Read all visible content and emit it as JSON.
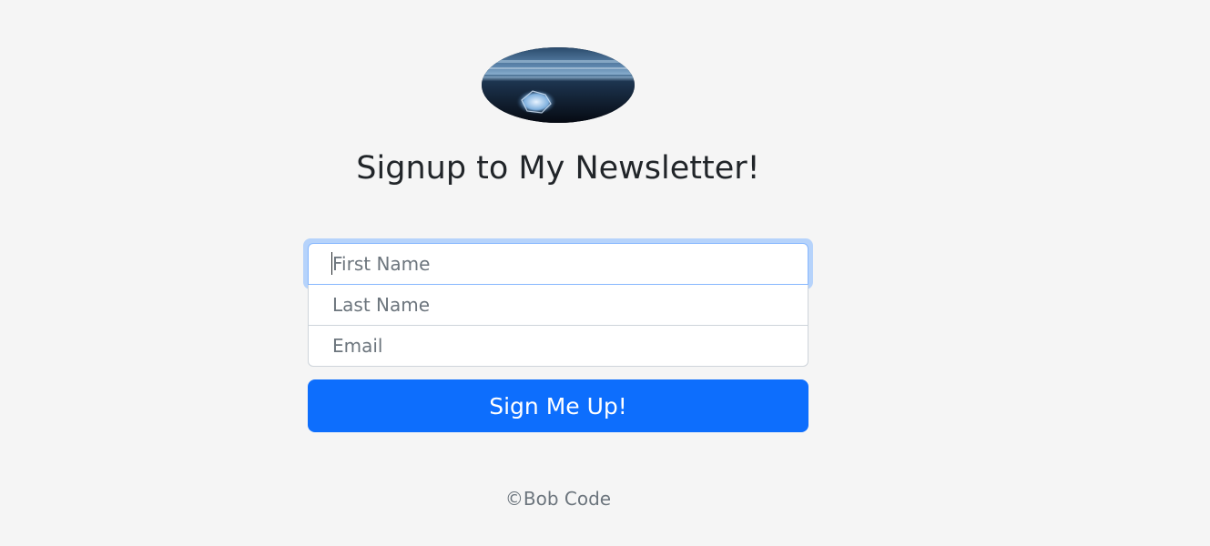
{
  "logo": {
    "icon": "ice-on-black-sand-beach-image"
  },
  "heading": {
    "text": "Signup to My Newsletter!"
  },
  "form": {
    "first_name": {
      "placeholder": "First Name",
      "value": ""
    },
    "last_name": {
      "placeholder": "Last Name",
      "value": ""
    },
    "email": {
      "placeholder": "Email",
      "value": ""
    },
    "submit_label": "Sign Me Up!"
  },
  "footer": {
    "text": "©Bob Code"
  },
  "colors": {
    "background": "#f5f5f5",
    "primary": "#0d6efd",
    "focus_ring": "#b6d3fb",
    "muted_text": "#6c757d"
  }
}
